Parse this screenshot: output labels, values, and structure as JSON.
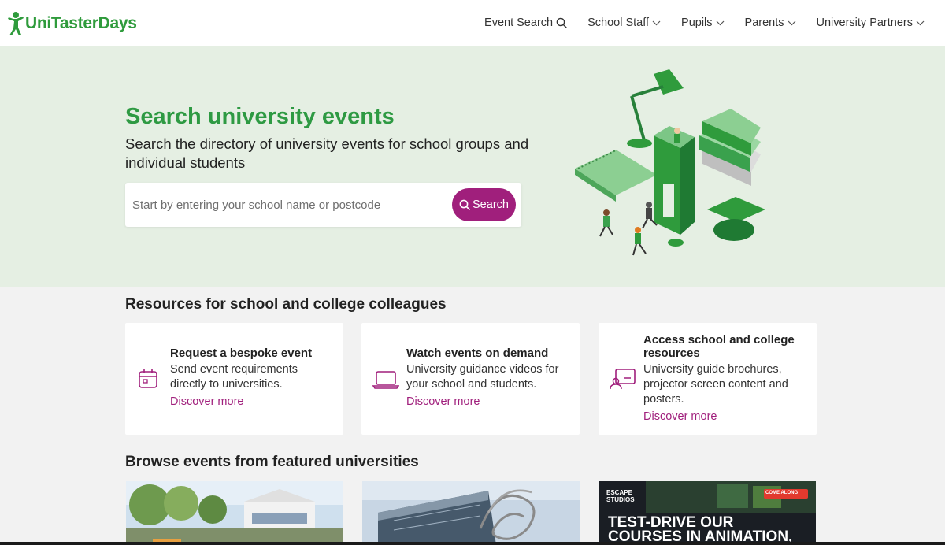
{
  "brand": {
    "name": "UniTasterDays",
    "color": "#2f9b3c"
  },
  "nav": {
    "items": [
      {
        "label": "Event Search",
        "icon": "search-icon"
      },
      {
        "label": "School Staff",
        "icon": "chevron-down-icon"
      },
      {
        "label": "Pupils",
        "icon": "chevron-down-icon"
      },
      {
        "label": "Parents",
        "icon": "chevron-down-icon"
      },
      {
        "label": "University Partners",
        "icon": "chevron-down-icon"
      }
    ]
  },
  "hero": {
    "title": "Search university events",
    "subtitle": "Search the directory of university events for school groups and individual students",
    "search_placeholder": "Start by entering your school name or postcode",
    "search_button": "Search",
    "accent": "#a01f7c"
  },
  "resources": {
    "title": "Resources for school and college colleagues",
    "cards": [
      {
        "title": "Request a bespoke event",
        "description": "Send event requirements directly to universities.",
        "link": "Discover more",
        "icon": "calendar-icon"
      },
      {
        "title": "Watch events on demand",
        "description": "University guidance videos for your school and students.",
        "link": "Discover more",
        "icon": "laptop-icon"
      },
      {
        "title": "Access school and college resources",
        "description": "University guide brochures, projector screen content and posters.",
        "link": "Discover more",
        "icon": "presentation-icon"
      }
    ]
  },
  "featured": {
    "title": "Browse events from featured universities",
    "cards": [
      {
        "overlay": ""
      },
      {
        "overlay": ""
      },
      {
        "brand": "ESCAPE STUDIOS",
        "badge": "COME ALONG",
        "headline": "TEST-DRIVE OUR COURSES IN ANIMATION,"
      }
    ]
  }
}
